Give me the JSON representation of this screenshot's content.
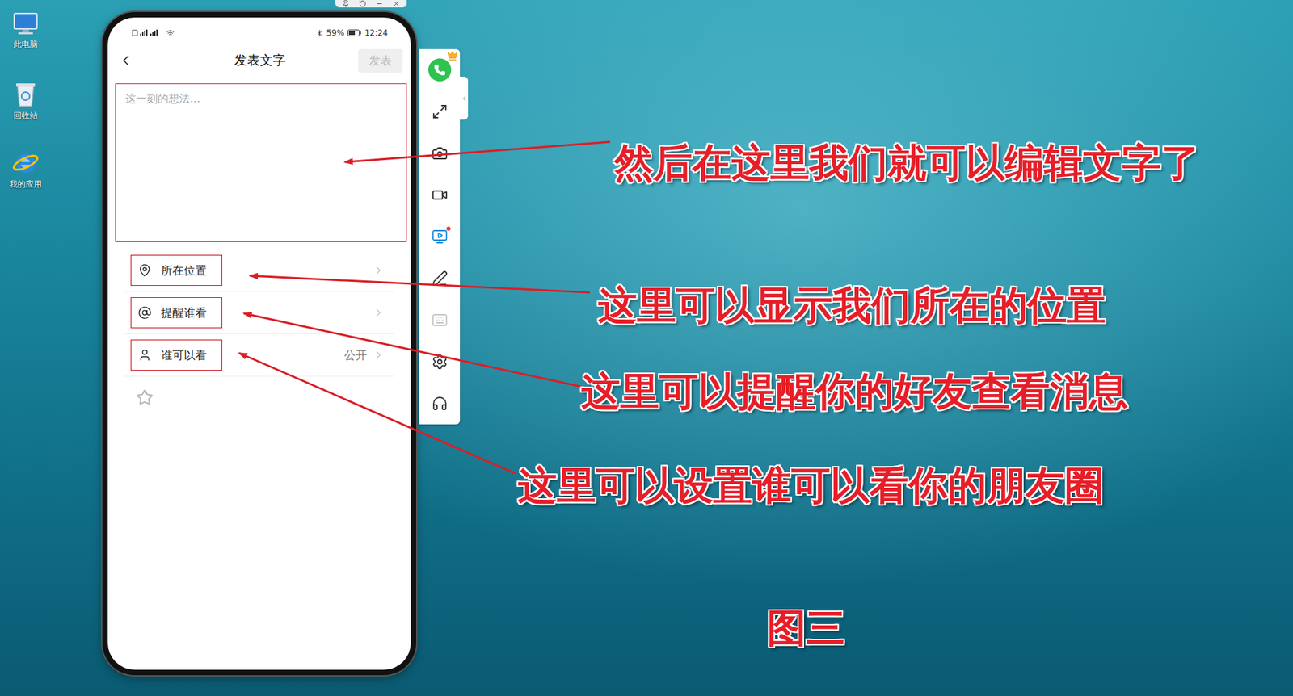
{
  "desktop": {
    "icons": [
      {
        "label": "此电脑",
        "kind": "computer"
      },
      {
        "label": "回收站",
        "kind": "recycle"
      },
      {
        "label": "我的应用",
        "kind": "browser"
      }
    ]
  },
  "phone": {
    "status_bar": {
      "battery": "59%",
      "time": "12:24"
    },
    "nav": {
      "title": "发表文字",
      "publish_button": {
        "label": "发表",
        "disabled": true
      }
    },
    "editor": {
      "placeholder": "这一刻的想法..."
    },
    "options": [
      {
        "label": "所在位置",
        "value": "",
        "kind": "location"
      },
      {
        "label": "提醒谁看",
        "value": "",
        "kind": "mention"
      },
      {
        "label": "谁可以看",
        "value": "公开",
        "kind": "visibility"
      }
    ]
  },
  "toolbar": {
    "items": [
      {
        "kind": "app",
        "disabled": false,
        "badge": false
      },
      {
        "kind": "fullscreen",
        "disabled": false,
        "badge": false
      },
      {
        "kind": "screenshot",
        "disabled": false,
        "badge": false
      },
      {
        "kind": "record",
        "disabled": false,
        "badge": false
      },
      {
        "kind": "cast",
        "disabled": false,
        "badge": true
      },
      {
        "kind": "pen",
        "disabled": false,
        "badge": false
      },
      {
        "kind": "keyboard",
        "disabled": true,
        "badge": false
      },
      {
        "kind": "settings",
        "disabled": false,
        "badge": false
      },
      {
        "kind": "support",
        "disabled": false,
        "badge": false
      }
    ]
  },
  "annotations": [
    {
      "text": "然后在这里我们就可以编辑文字了"
    },
    {
      "text": "这里可以显示我们所在的位置"
    },
    {
      "text": "这里可以提醒你的好友查看消息"
    },
    {
      "text": "这里可以设置谁可以看你的朋友圈"
    }
  ],
  "figure_label": "图三"
}
